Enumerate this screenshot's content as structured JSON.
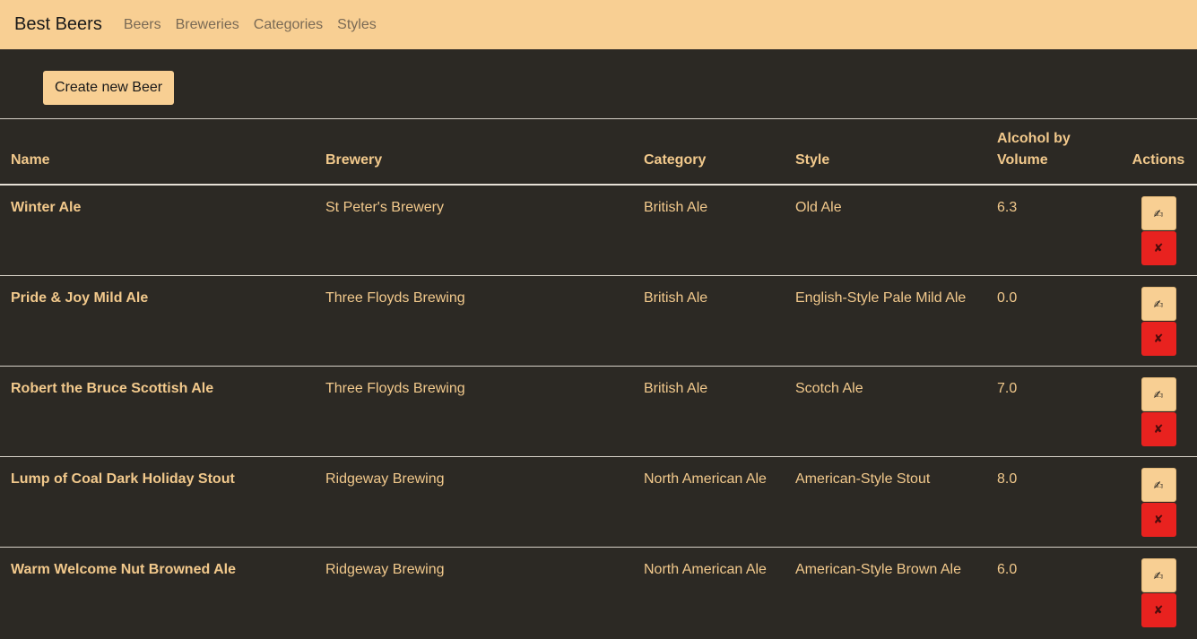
{
  "navbar": {
    "brand": "Best Beers",
    "links": [
      "Beers",
      "Breweries",
      "Categories",
      "Styles"
    ]
  },
  "toolbar": {
    "create_label": "Create new Beer"
  },
  "table": {
    "headers": {
      "name": "Name",
      "brewery": "Brewery",
      "category": "Category",
      "style": "Style",
      "abv": "Alcohol by Volume",
      "actions": "Actions"
    },
    "rows": [
      {
        "name": "Winter Ale",
        "brewery": "St Peter's Brewery",
        "category": "British Ale",
        "style": "Old Ale",
        "abv": "6.3"
      },
      {
        "name": "Pride & Joy Mild Ale",
        "brewery": "Three Floyds Brewing",
        "category": "British Ale",
        "style": "English-Style Pale Mild Ale",
        "abv": "0.0"
      },
      {
        "name": "Robert the Bruce Scottish Ale",
        "brewery": "Three Floyds Brewing",
        "category": "British Ale",
        "style": "Scotch Ale",
        "abv": "7.0"
      },
      {
        "name": "Lump of Coal Dark Holiday Stout",
        "brewery": "Ridgeway Brewing",
        "category": "North American Ale",
        "style": "American-Style Stout",
        "abv": "8.0"
      },
      {
        "name": "Warm Welcome Nut Browned Ale",
        "brewery": "Ridgeway Brewing",
        "category": "North American Ale",
        "style": "American-Style Brown Ale",
        "abv": "6.0"
      }
    ],
    "edit_glyph": "✍",
    "delete_glyph": "✘"
  },
  "colors": {
    "navbar_bg": "#f8cf93",
    "page_bg": "#2c2924",
    "text_accent": "#f2c98c",
    "delete_red": "#e8221f"
  }
}
